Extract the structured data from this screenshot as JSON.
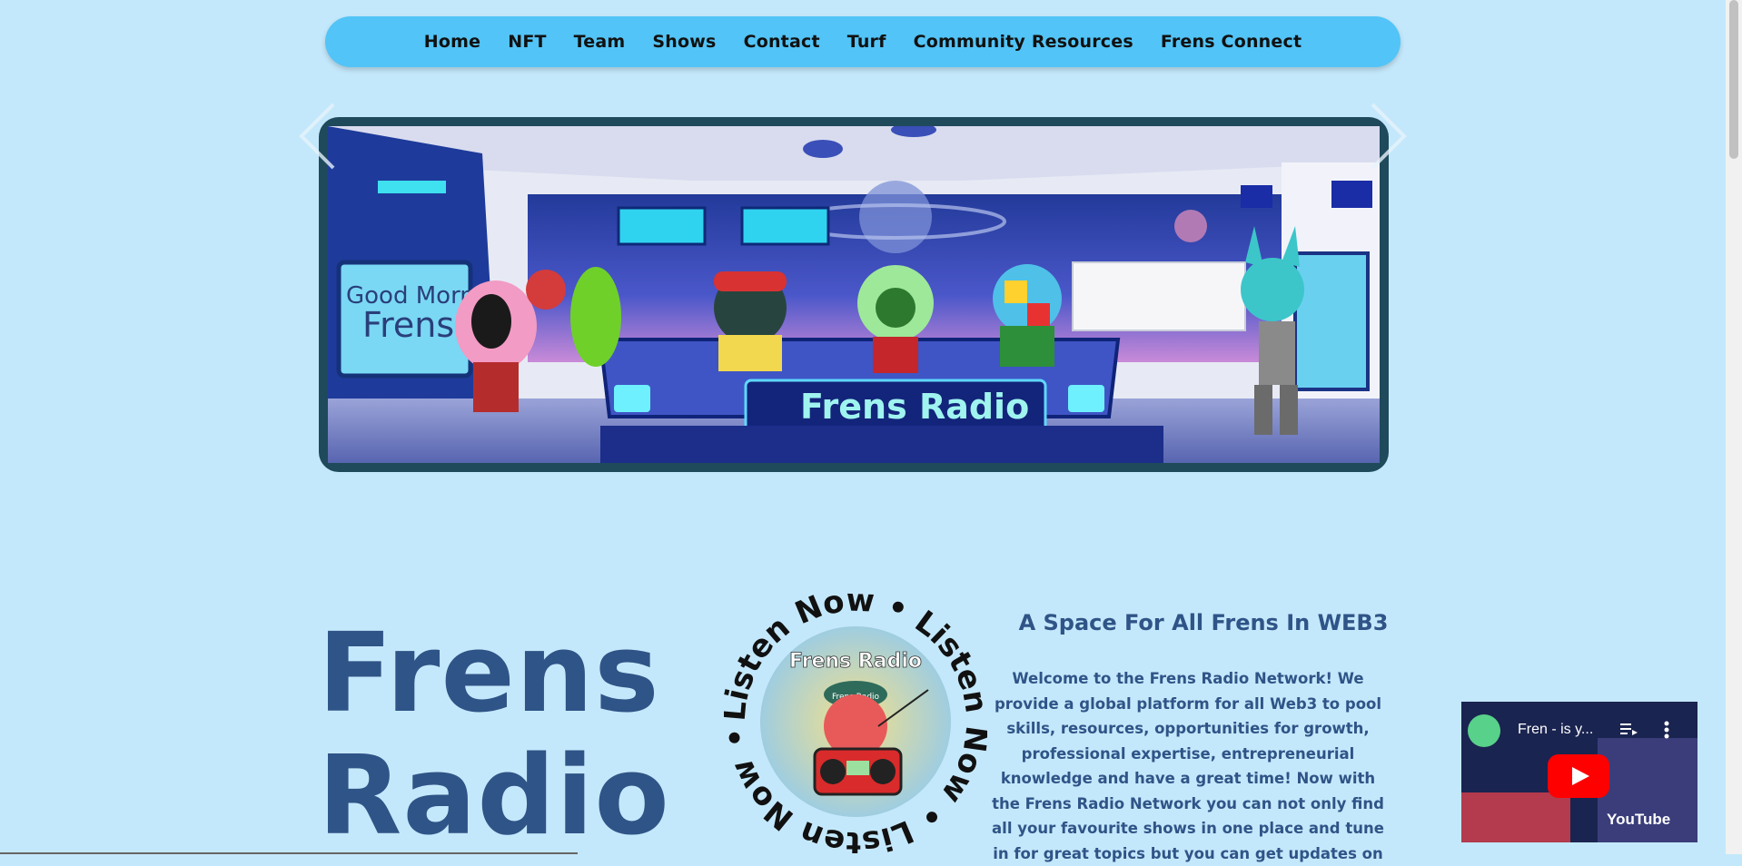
{
  "nav": {
    "items": [
      "Home",
      "NFT",
      "Team",
      "Shows",
      "Contact",
      "Turf",
      "Community Resources",
      "Frens Connect"
    ]
  },
  "hero": {
    "sign_left": "Good Morning Frens",
    "desk_sign": "Frens Radio"
  },
  "main": {
    "title_line1": "Frens",
    "title_line2": "Radio",
    "badge_ring_text": "Listen Now • Listen Now • Listen Now •",
    "badge_inner_text": "Frens Radio",
    "badge_cap_text": "Frens Radio",
    "tagline": "A Space For All Frens In WEB3",
    "description": "Welcome to the Frens Radio Network! We provide a global platform for all Web3 to pool skills, resources, opportunities for growth, professional expertise, entrepreneurial knowledge and have a great time! Now with the Frens Radio Network you can not only find all your favourite shows in one place and tune in for great topics but you can get updates on"
  },
  "video": {
    "title": "Fren - is y...",
    "logo": "YouTube"
  },
  "colors": {
    "background": "#c4e8fb",
    "nav": "#52c4f7",
    "heading": "#2f5487",
    "youtube_red": "#ff0000"
  },
  "icons": [
    "chevron-left-icon",
    "chevron-right-icon",
    "play-icon",
    "playlist-icon",
    "more-vertical-icon"
  ]
}
